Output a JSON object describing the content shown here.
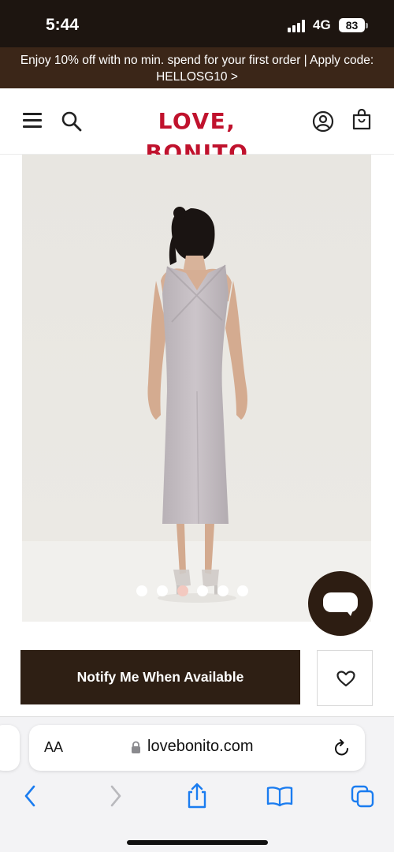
{
  "status_bar": {
    "time": "5:44",
    "network": "4G",
    "battery": "83"
  },
  "promo": {
    "line1": "Enjoy 10% off with no min. spend for your first order | Apply code:",
    "line2": "HELLOSG10 >"
  },
  "header": {
    "logo": "LOVE, BONITO",
    "brand_color": "#c0122d"
  },
  "icons": {
    "menu": "hamburger-menu-icon",
    "search": "search-icon",
    "account": "user-account-icon",
    "bag": "shopping-bag-icon",
    "wishlist": "heart-icon",
    "chat": "chat-icon"
  },
  "carousel": {
    "total": 6,
    "active_index": 2
  },
  "product": {
    "notify_label": "Notify Me When Available"
  },
  "browser": {
    "text_size_label": "AA",
    "url": "lovebonito.com"
  },
  "colors": {
    "status_bar_bg": "#1d1510",
    "promo_bg": "#3b2618",
    "button_bg": "#2e1f14",
    "browser_accent": "#1a7cf0"
  }
}
